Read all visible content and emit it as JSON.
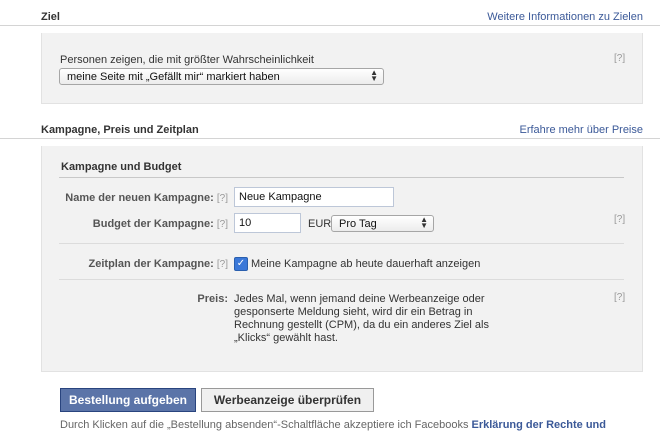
{
  "ziel": {
    "title": "Ziel",
    "more_link": "Weitere Informationen zu Zielen",
    "prompt": "Personen zeigen, die mit größter Wahrscheinlichkeit",
    "select_value": "meine Seite mit „Gefällt mir“ markiert haben",
    "help": "[?]"
  },
  "kampagne": {
    "title": "Kampagne, Preis und Zeitplan",
    "more_link": "Erfahre mehr über Preise",
    "subsection_title": "Kampagne und Budget",
    "name_label": "Name der neuen Kampagne:",
    "name_help": "[?]",
    "name_value": "Neue Kampagne",
    "budget_label": "Budget der Kampagne:",
    "budget_help": "[?]",
    "budget_value": "10",
    "currency": "EUR",
    "period_value": "Pro Tag",
    "budget_side_help": "[?]",
    "schedule_label": "Zeitplan der Kampagne:",
    "schedule_help": "[?]",
    "schedule_checkbox_label": "Meine Kampagne ab heute dauerhaft anzeigen",
    "schedule_checked": true,
    "price_label": "Preis:",
    "price_text_1": "Jedes Mal, wenn jemand deine Werbeanzeige oder",
    "price_text_2": "gesponserte Meldung sieht, wird dir ein Betrag in",
    "price_text_3": "Rechnung gestellt (CPM), da du ein anderes Ziel als",
    "price_text_4": "„Klicks“ gewählt hast.",
    "price_side_help": "[?]"
  },
  "actions": {
    "place_order": "Bestellung aufgeben",
    "review_ad": "Werbeanzeige überprüfen"
  },
  "footer": {
    "text": "Durch Klicken auf die „Bestellung absenden“-Schaltfläche akzeptiere ich Facebooks ",
    "link": "Erklärung der Rechte und"
  },
  "colors": {
    "link": "#3b5998",
    "primary_button": "#5b74a8",
    "panel_bg": "#f2f2f2",
    "checkbox": "#3b78d8"
  }
}
